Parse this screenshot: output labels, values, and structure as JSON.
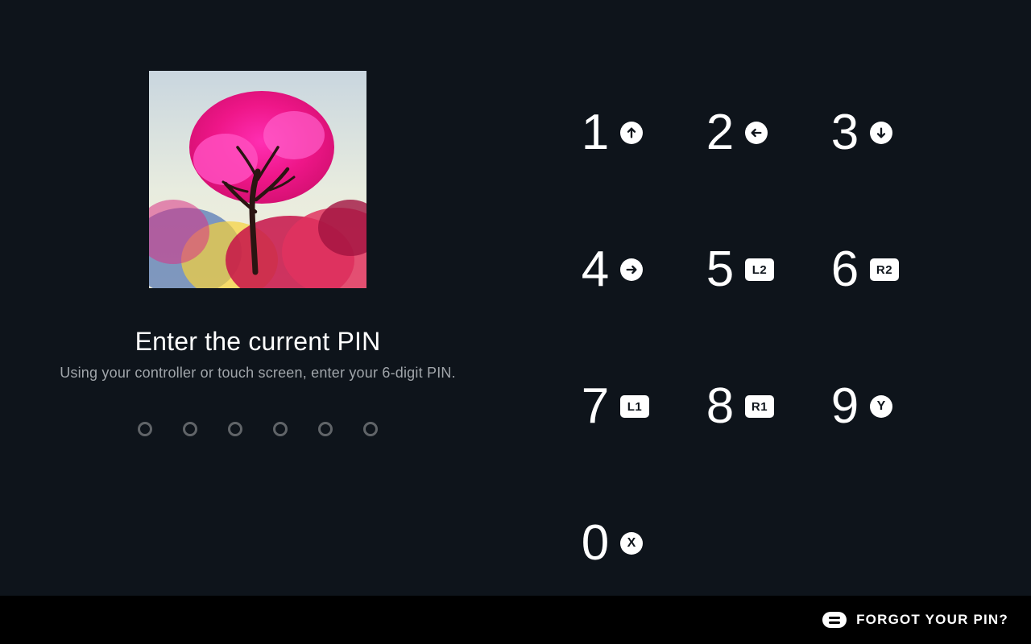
{
  "title": "Enter the current PIN",
  "subtitle": "Using your controller or touch screen, enter your 6-digit PIN.",
  "pin_length": 6,
  "keypad": [
    {
      "digit": "1",
      "badge_type": "arrow-up",
      "name": "key-1"
    },
    {
      "digit": "2",
      "badge_type": "arrow-left",
      "name": "key-2"
    },
    {
      "digit": "3",
      "badge_type": "arrow-down",
      "name": "key-3"
    },
    {
      "digit": "4",
      "badge_type": "arrow-right",
      "name": "key-4"
    },
    {
      "digit": "5",
      "badge_type": "square-text",
      "badge_text": "L2",
      "name": "key-5"
    },
    {
      "digit": "6",
      "badge_type": "square-text",
      "badge_text": "R2",
      "name": "key-6"
    },
    {
      "digit": "7",
      "badge_type": "square-text",
      "badge_text": "L1",
      "name": "key-7"
    },
    {
      "digit": "8",
      "badge_type": "square-text",
      "badge_text": "R1",
      "name": "key-8"
    },
    {
      "digit": "9",
      "badge_type": "circle-text",
      "badge_text": "Y",
      "name": "key-9"
    },
    {
      "digit": "0",
      "badge_type": "circle-text",
      "badge_text": "X",
      "name": "key-0"
    }
  ],
  "footer": {
    "forgot_label": "FORGOT YOUR PIN?"
  }
}
